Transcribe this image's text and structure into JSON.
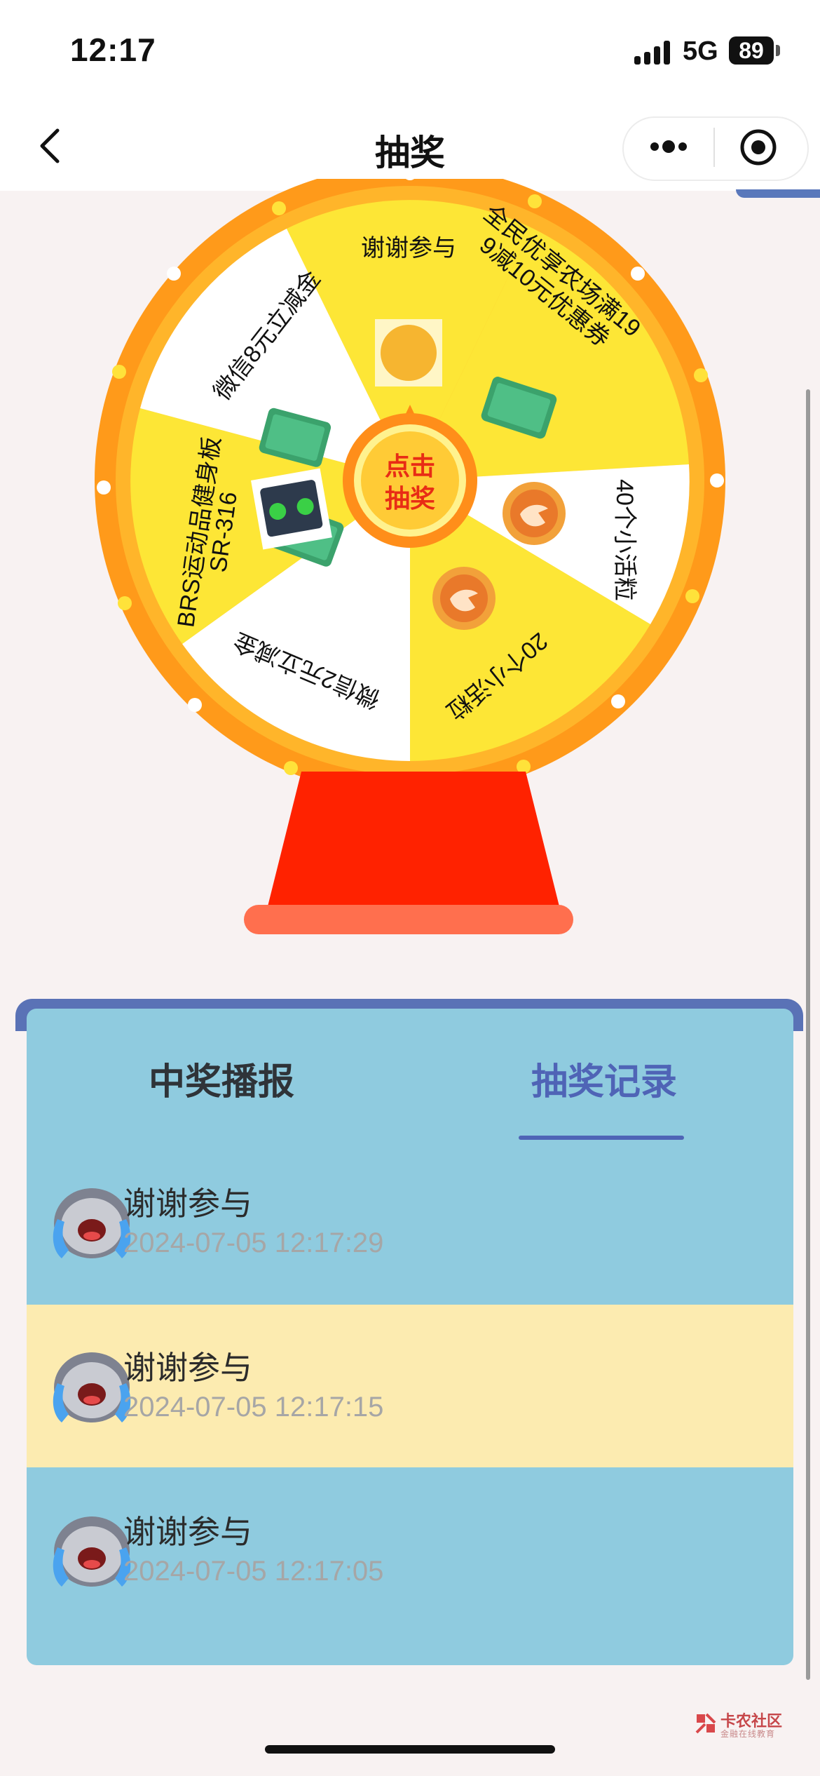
{
  "status_bar": {
    "time": "12:17",
    "network": "5G",
    "battery": "89"
  },
  "nav": {
    "title": "抽奖",
    "back_icon": "chevron-left-icon",
    "more_icon": "more-dots-icon",
    "close_icon": "target-close-icon"
  },
  "wheel": {
    "center_label_line1": "点击",
    "center_label_line2": "抽奖",
    "segments": [
      {
        "label": "谢谢参与",
        "icon_text": "谢谢\n参与"
      },
      {
        "label_line1": "全民优享农场满19",
        "label_line2": "9减10元优惠券",
        "coupon_value": "10"
      },
      {
        "label": "40个小活粒"
      },
      {
        "label": "20个小活粒"
      },
      {
        "label": "微信2元立减金",
        "coupon_value": "2"
      },
      {
        "label_line1": "BRS运动品健身板",
        "label_line2": "SR-316"
      },
      {
        "label": "微信8元立减金",
        "coupon_value": "8"
      }
    ],
    "colors": {
      "yellow": "#fde636",
      "white": "#ffffff",
      "rim": "#ff9a1a",
      "stand": "#ff2200"
    }
  },
  "records": {
    "tabs": [
      {
        "label": "中奖播报",
        "active": false
      },
      {
        "label": "抽奖记录",
        "active": true
      }
    ],
    "items": [
      {
        "title": "谢谢参与",
        "time": "2024-07-05 12:17:29"
      },
      {
        "title": "谢谢参与",
        "time": "2024-07-05 12:17:15"
      },
      {
        "title": "谢谢参与",
        "time": "2024-07-05 12:17:05"
      }
    ]
  },
  "watermark": {
    "text": "卡农社区",
    "sub": "金融在线教育"
  }
}
